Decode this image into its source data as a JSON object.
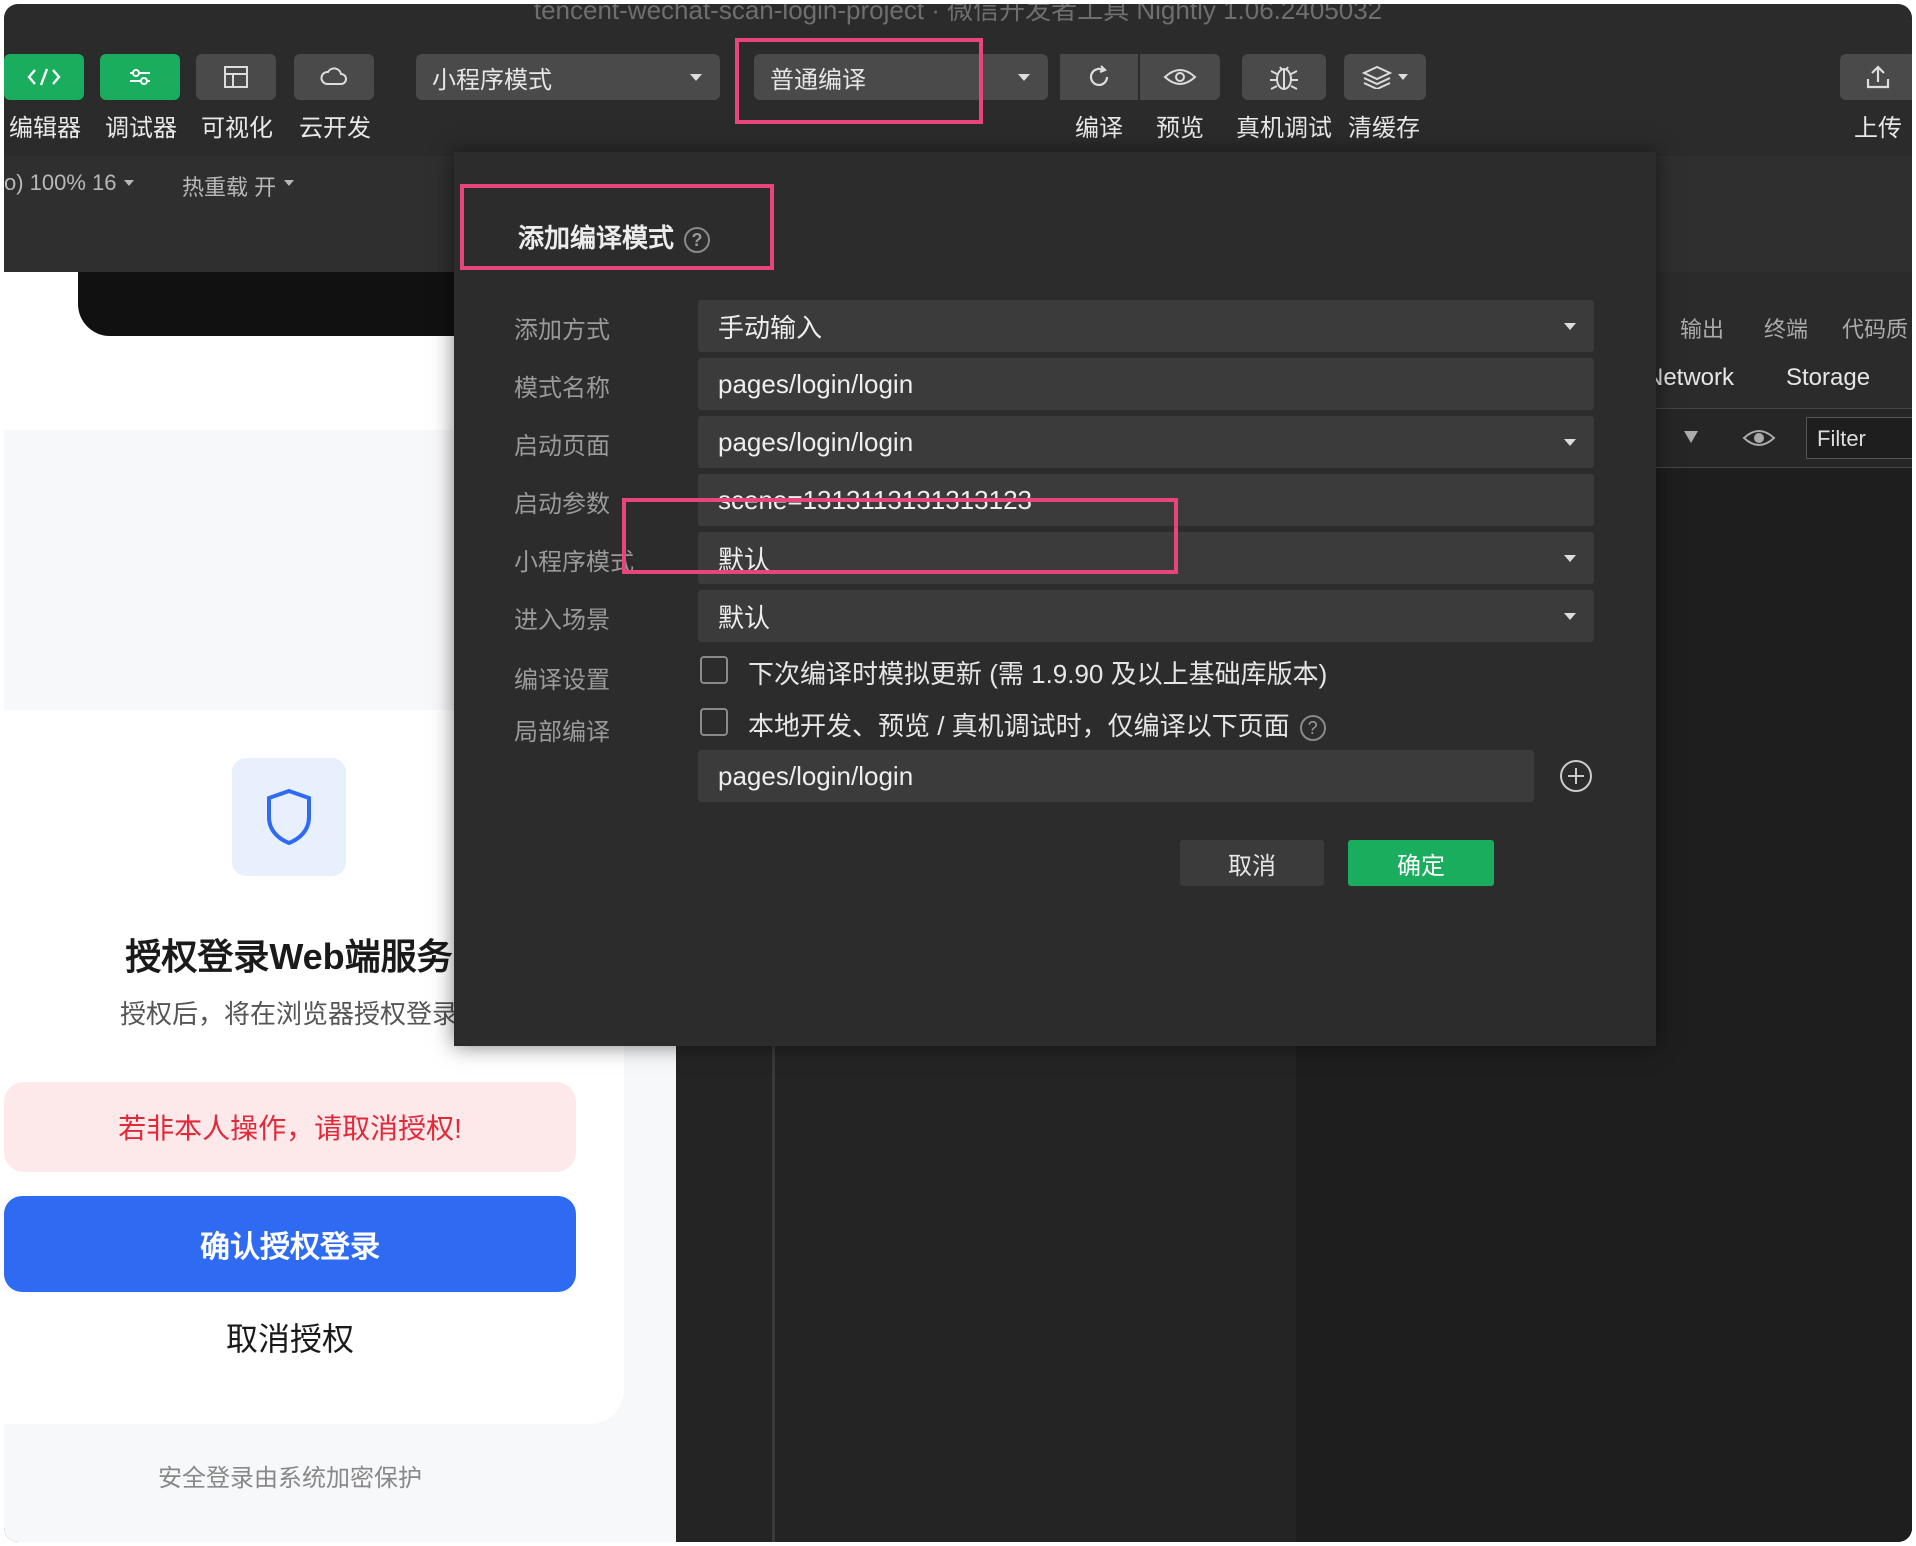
{
  "window_title": "tencent-wechat-scan-login-project · 微信开发者工具 Nightly 1.06.2405032",
  "toolbar": {
    "left_buttons": [
      {
        "label": "编辑器",
        "icon": "code-icon"
      },
      {
        "label": "调试器",
        "icon": "sliders-icon"
      },
      {
        "label": "可视化",
        "icon": "layout-icon"
      },
      {
        "label": "云开发",
        "icon": "cloud-icon"
      }
    ],
    "mode_select": "小程序模式",
    "compile_select": "普通编译",
    "right_buttons": [
      {
        "label": "编译",
        "icon": "refresh-icon"
      },
      {
        "label": "预览",
        "icon": "eye-icon"
      },
      {
        "label": "真机调试",
        "icon": "bug-icon"
      },
      {
        "label": "清缓存",
        "icon": "layers-icon"
      }
    ],
    "upload_label": "上传"
  },
  "subbar": {
    "zoom": "o) 100% 16",
    "hot_reload": "热重载 开"
  },
  "devtools": {
    "tabs_top": [
      "输出",
      "终端",
      "代码质"
    ],
    "tabs_second": [
      "Network",
      "Storage"
    ],
    "filter_placeholder": "Filter"
  },
  "simulator": {
    "auth_title": "授权登录Web端服务",
    "auth_desc": "授权后，将在浏览器授权登录",
    "warning": "若非本人操作，请取消授权!",
    "confirm_button": "确认授权登录",
    "cancel_link": "取消授权",
    "footer": "安全登录由系统加密保护"
  },
  "dialog": {
    "title": "添加编译模式",
    "help": "?",
    "rows": {
      "add_method_label": "添加方式",
      "add_method_value": "手动输入",
      "mode_name_label": "模式名称",
      "mode_name_value": "pages/login/login",
      "start_page_label": "启动页面",
      "start_page_value": "pages/login/login",
      "start_params_label": "启动参数",
      "start_params_value": "scene=1313113131313123",
      "mini_mode_label": "小程序模式",
      "mini_mode_value": "默认",
      "scene_label": "进入场景",
      "scene_value": "默认",
      "compile_settings_label": "编译设置",
      "compile_settings_checkbox": "下次编译时模拟更新 (需 1.9.90 及以上基础库版本)",
      "partial_compile_label": "局部编译",
      "partial_compile_checkbox": "本地开发、预览 / 真机调试时，仅编译以下页面",
      "partial_page_value": "pages/login/login"
    },
    "cancel": "取消",
    "ok": "确定"
  },
  "colors": {
    "accent_green": "#1aad5e",
    "highlight_pink": "#e8457a",
    "primary_blue": "#2f6bf2",
    "warning_red": "#e02a3a"
  }
}
